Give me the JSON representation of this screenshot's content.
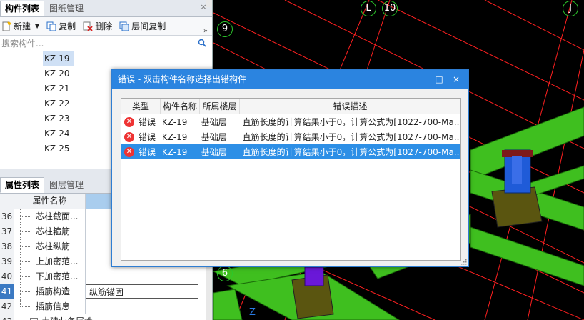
{
  "left_top": {
    "tabs": [
      "构件列表",
      "图纸管理"
    ],
    "close_glyph": "×",
    "toolbar": {
      "new_label": "新建",
      "copy_label": "复制",
      "delete_label": "删除",
      "floor_copy_label": "层间复制",
      "more_glyph": "»"
    },
    "search": {
      "placeholder": "搜索构件...",
      "icon": "search-icon"
    },
    "components": [
      "KZ-19",
      "KZ-20",
      "KZ-21",
      "KZ-22",
      "KZ-23",
      "KZ-24",
      "KZ-25"
    ],
    "selected_component": "KZ-19"
  },
  "props": {
    "tabs": [
      "属性列表",
      "图层管理"
    ],
    "header_name": "属性名称",
    "rows": [
      {
        "num": "36",
        "name": "芯柱截面...",
        "value": ""
      },
      {
        "num": "37",
        "name": "芯柱箍筋",
        "value": ""
      },
      {
        "num": "38",
        "name": "芯柱纵筋",
        "value": ""
      },
      {
        "num": "39",
        "name": "上加密范...",
        "value": ""
      },
      {
        "num": "40",
        "name": "下加密范...",
        "value": ""
      },
      {
        "num": "41",
        "name": "插筋构造",
        "value": "纵筋锚固"
      },
      {
        "num": "42",
        "name": "插筋信息",
        "value": ""
      },
      {
        "num": "43",
        "name": "土建业务属性",
        "value": ""
      }
    ],
    "selected_row": "41",
    "expander": "+"
  },
  "viewport": {
    "axis_labels": [
      "L",
      "10",
      "J",
      "9",
      "6"
    ],
    "z_label": "Z"
  },
  "dialog": {
    "title": "错误 - 双击构件名称选择出错构件",
    "maximize_glyph": "□",
    "close_glyph": "×",
    "columns": [
      "类型",
      "构件名称",
      "所属楼层",
      "错误描述"
    ],
    "rows": [
      {
        "type": "错误",
        "name": "KZ-19",
        "floor": "基础层",
        "desc": "直筋长度的计算结果小于0，计算公式为[1022-700-Ma..."
      },
      {
        "type": "错误",
        "name": "KZ-19",
        "floor": "基础层",
        "desc": "直筋长度的计算结果小于0，计算公式为[1027-700-Ma..."
      },
      {
        "type": "错误",
        "name": "KZ-19",
        "floor": "基础层",
        "desc": "直筋长度的计算结果小于0，计算公式为[1027-700-Ma..."
      }
    ],
    "selected_row_index": 2,
    "error_glyph": "✕"
  },
  "colors": {
    "accent": "#2b84e0",
    "selection": "#2d8fe6",
    "error": "#e33333",
    "beam_green": "#3fbf1f",
    "grid_red": "#ff2020",
    "column_blue": "#1f5bd8",
    "footing_olive": "#5a5510"
  }
}
